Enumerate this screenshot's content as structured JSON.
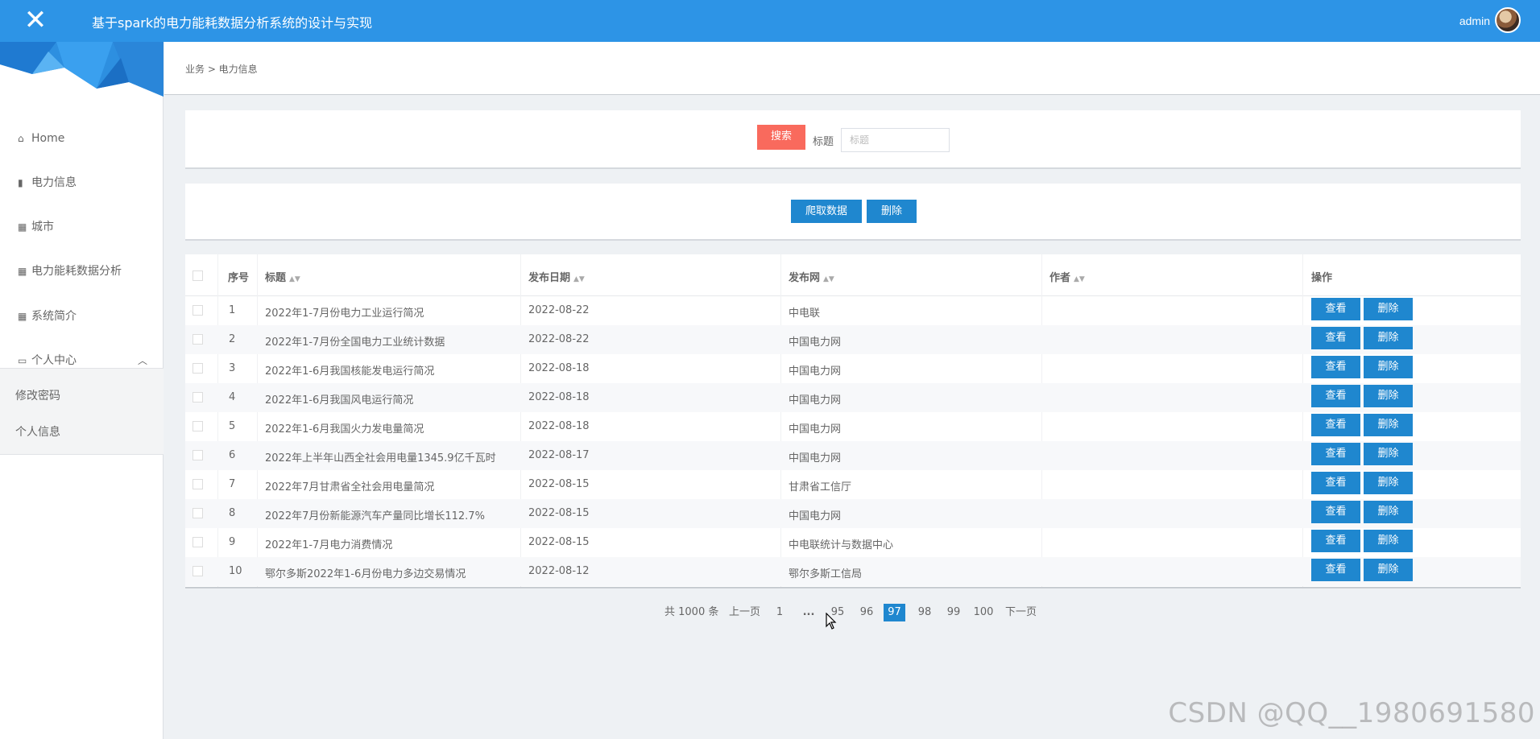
{
  "header": {
    "title": "基于spark的电力能耗数据分析系统的设计与实现",
    "user": "admin"
  },
  "sidebar": {
    "items": [
      {
        "label": "Home"
      },
      {
        "label": "电力信息"
      },
      {
        "label": "城市"
      },
      {
        "label": "电力能耗数据分析"
      },
      {
        "label": "系统简介"
      },
      {
        "label": "个人中心"
      }
    ],
    "submenu": [
      {
        "label": "修改密码"
      },
      {
        "label": "个人信息"
      }
    ]
  },
  "breadcrumb": "业务 > 电力信息",
  "search": {
    "button": "搜索",
    "label": "标题",
    "placeholder": "标题"
  },
  "actions": {
    "crawl": "爬取数据",
    "delete": "删除"
  },
  "table": {
    "headers": {
      "index": "序号",
      "title": "标题",
      "date": "发布日期",
      "source": "发布网",
      "author": "作者",
      "ops": "操作"
    },
    "view_label": "查看",
    "delete_label": "删除",
    "rows": [
      {
        "index": "1",
        "title": "2022年1-7月份电力工业运行简况",
        "date": "2022-08-22",
        "source": "中电联",
        "author": ""
      },
      {
        "index": "2",
        "title": "2022年1-7月份全国电力工业统计数据",
        "date": "2022-08-22",
        "source": "中国电力网",
        "author": ""
      },
      {
        "index": "3",
        "title": "2022年1-6月我国核能发电运行简况",
        "date": "2022-08-18",
        "source": "中国电力网",
        "author": ""
      },
      {
        "index": "4",
        "title": "2022年1-6月我国风电运行简况",
        "date": "2022-08-18",
        "source": "中国电力网",
        "author": ""
      },
      {
        "index": "5",
        "title": "2022年1-6月我国火力发电量简况",
        "date": "2022-08-18",
        "source": "中国电力网",
        "author": ""
      },
      {
        "index": "6",
        "title": "2022年上半年山西全社会用电量1345.9亿千瓦时",
        "date": "2022-08-17",
        "source": "中国电力网",
        "author": ""
      },
      {
        "index": "7",
        "title": "2022年7月甘肃省全社会用电量简况",
        "date": "2022-08-15",
        "source": "甘肃省工信厅",
        "author": ""
      },
      {
        "index": "8",
        "title": "2022年7月份新能源汽车产量同比增长112.7%",
        "date": "2022-08-15",
        "source": "中国电力网",
        "author": ""
      },
      {
        "index": "9",
        "title": "2022年1-7月电力消费情况",
        "date": "2022-08-15",
        "source": "中电联统计与数据中心",
        "author": ""
      },
      {
        "index": "10",
        "title": "鄂尔多斯2022年1-6月份电力多边交易情况",
        "date": "2022-08-12",
        "source": "鄂尔多斯工信局",
        "author": ""
      }
    ]
  },
  "pagination": {
    "total": "共 1000 条",
    "prev": "上一页",
    "next": "下一页",
    "pages": [
      "1",
      "...",
      "95",
      "96",
      "97",
      "98",
      "99",
      "100"
    ],
    "current": "97"
  },
  "watermark": "CSDN @QQ__1980691580"
}
